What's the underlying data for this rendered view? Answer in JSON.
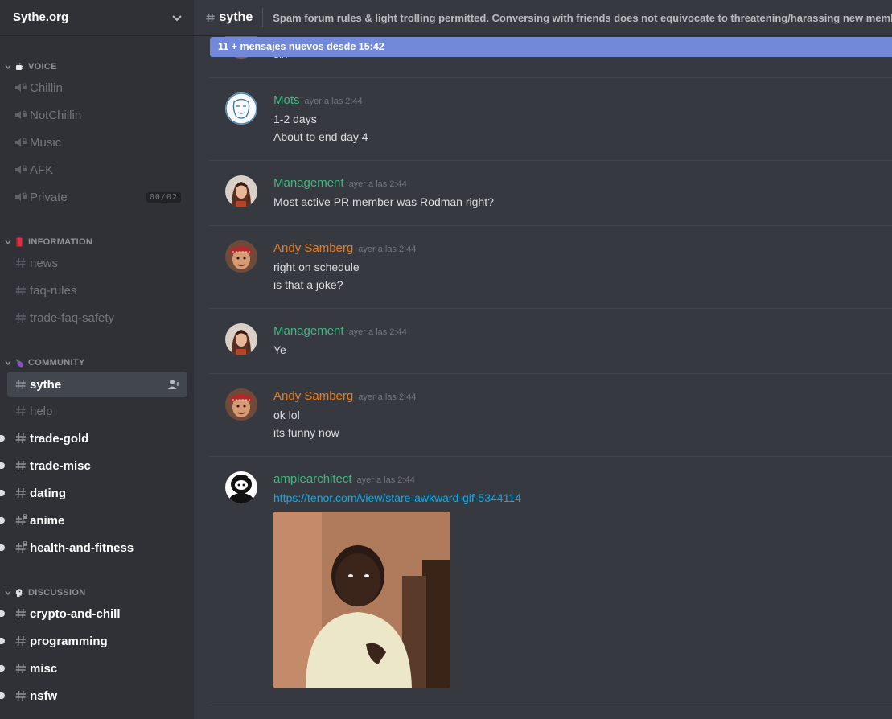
{
  "server": {
    "name": "Sythe.org"
  },
  "categories": {
    "voice": "VOICE",
    "information": "INFORMATION",
    "community": "COMMUNITY",
    "discussion": "DISCUSSION"
  },
  "voice_channels": [
    {
      "name": "Chillin"
    },
    {
      "name": "NotChillin"
    },
    {
      "name": "Music"
    },
    {
      "name": "AFK"
    },
    {
      "name": "Private",
      "user_limit": "00/02"
    }
  ],
  "information_channels": [
    {
      "name": "news"
    },
    {
      "name": "faq-rules"
    },
    {
      "name": "trade-faq-safety"
    }
  ],
  "community_channels": [
    {
      "name": "sythe",
      "state": "selected"
    },
    {
      "name": "help",
      "state": "read"
    },
    {
      "name": "trade-gold",
      "state": "unread"
    },
    {
      "name": "trade-misc",
      "state": "unread"
    },
    {
      "name": "dating",
      "state": "unread"
    },
    {
      "name": "anime",
      "state": "unread"
    },
    {
      "name": "health-and-fitness",
      "state": "unread"
    }
  ],
  "discussion_channels": [
    {
      "name": "crypto-and-chill",
      "state": "unread"
    },
    {
      "name": "programming",
      "state": "unread"
    },
    {
      "name": "misc",
      "state": "unread"
    },
    {
      "name": "nsfw",
      "state": "unread"
    }
  ],
  "header": {
    "channel": "sythe",
    "topic": "Spam forum rules & light trolling permitted. Conversing with friends does not equivocate to threatening/harassing new members."
  },
  "new_messages_bar": "11 + mensajes nuevos desde 15:42",
  "partial_message": "six",
  "messages": [
    {
      "author": "Mots",
      "color": "#43b581",
      "timestamp": "ayer a las 2:44",
      "lines": [
        "1-2 days",
        "About to end day 4"
      ]
    },
    {
      "author": "Management",
      "color": "#43b581",
      "timestamp": "ayer a las 2:44",
      "lines": [
        "Most active PR member was Rodman right?"
      ]
    },
    {
      "author": "Andy Samberg",
      "color": "#e67e22",
      "timestamp": "ayer a las 2:44",
      "lines": [
        "right on schedule",
        "is that a joke?"
      ]
    },
    {
      "author": "Management",
      "color": "#43b581",
      "timestamp": "ayer a las 2:44",
      "lines": [
        "Ye"
      ]
    },
    {
      "author": "Andy Samberg",
      "color": "#e67e22",
      "timestamp": "ayer a las 2:44",
      "lines": [
        "ok lol",
        "its funny now"
      ]
    },
    {
      "author": "amplearchitect",
      "color": "#43b581",
      "timestamp": "ayer a las 2:44",
      "link": "https://tenor.com/view/stare-awkward-gif-5344114"
    }
  ],
  "colors": {
    "sidebar_bg": "#2f3136",
    "chat_bg": "#36393f",
    "accent": "#7289da",
    "link": "#00b0f4"
  }
}
